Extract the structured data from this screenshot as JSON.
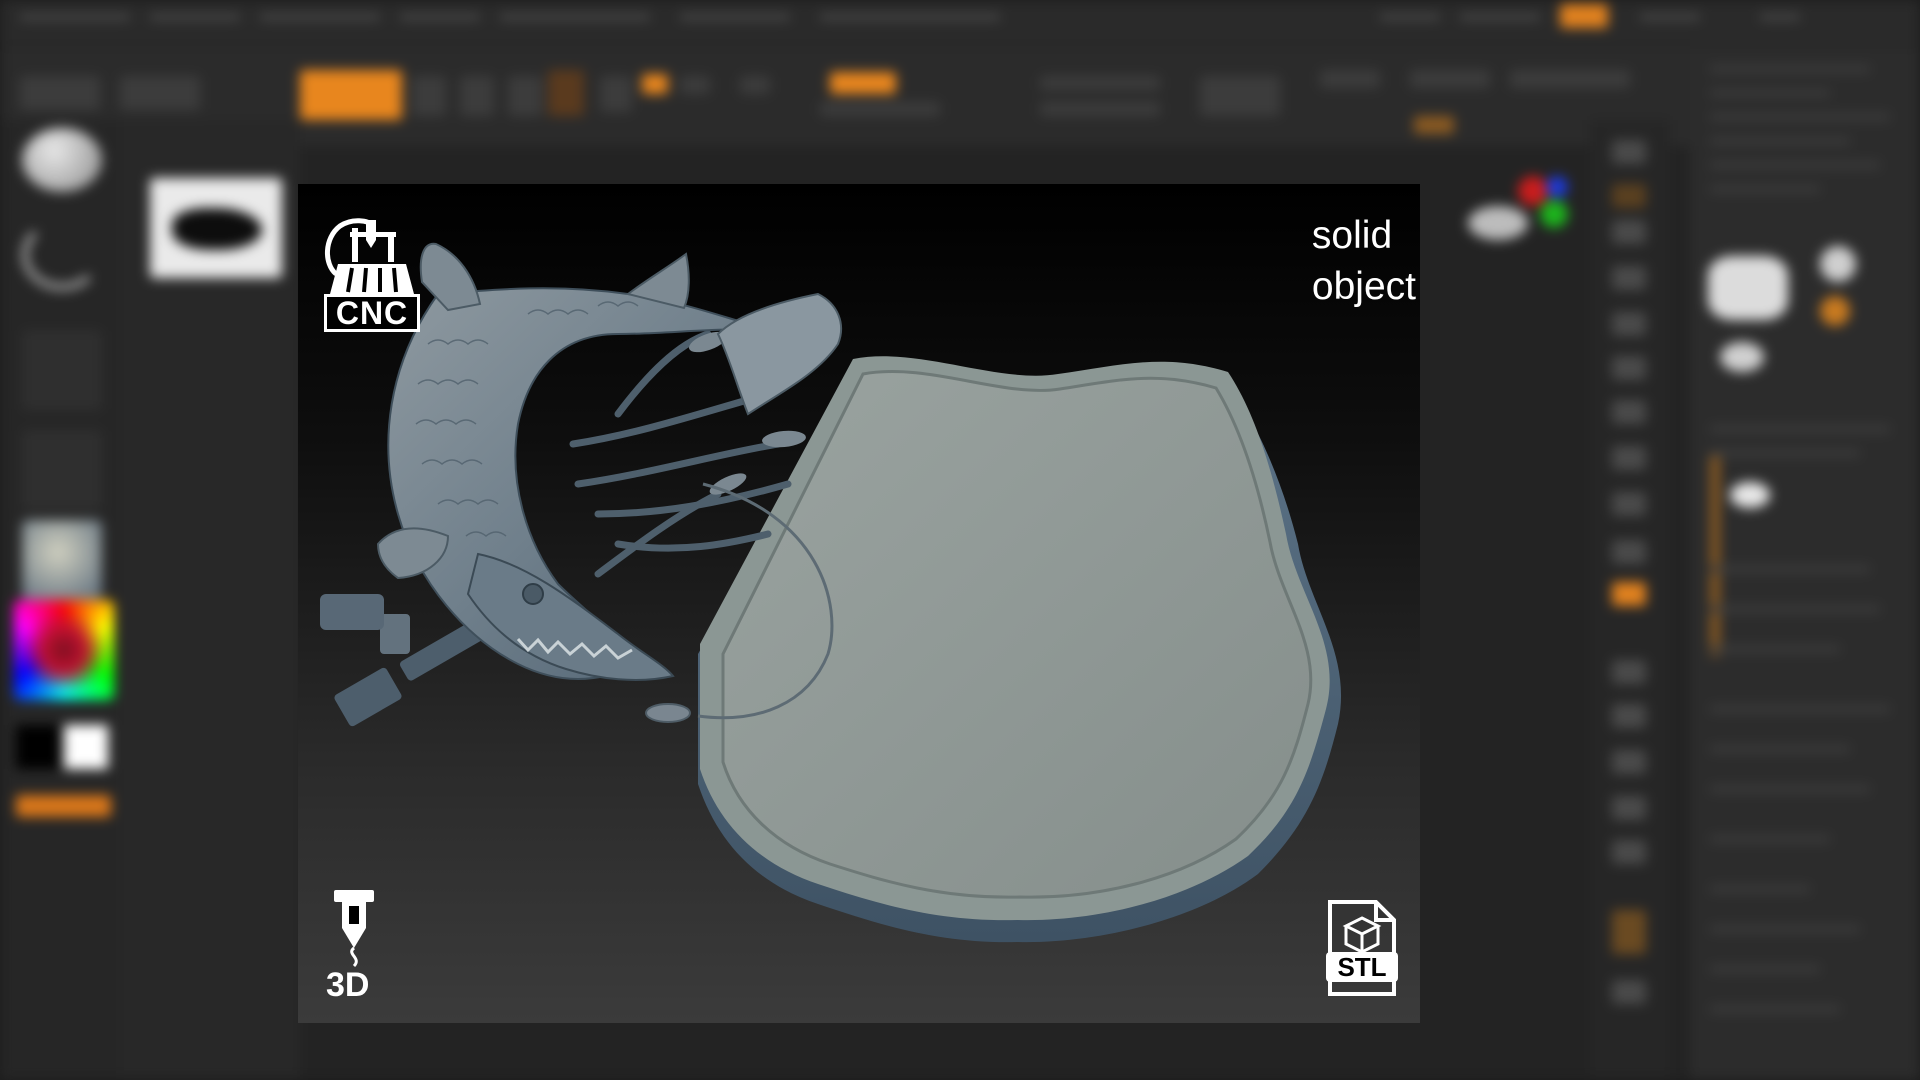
{
  "app": {
    "name": "ZBrush-like 3D sculpting application (blurred)",
    "accent_color": "#e8861e"
  },
  "viewport": {
    "caption_line1": "solid",
    "caption_line2": "object",
    "badges": {
      "cnc_label": "CNC",
      "print3d_label": "3D",
      "stl_label": "STL"
    }
  },
  "palette": {
    "primary_color": "#000000",
    "secondary_color": "#ffffff"
  }
}
